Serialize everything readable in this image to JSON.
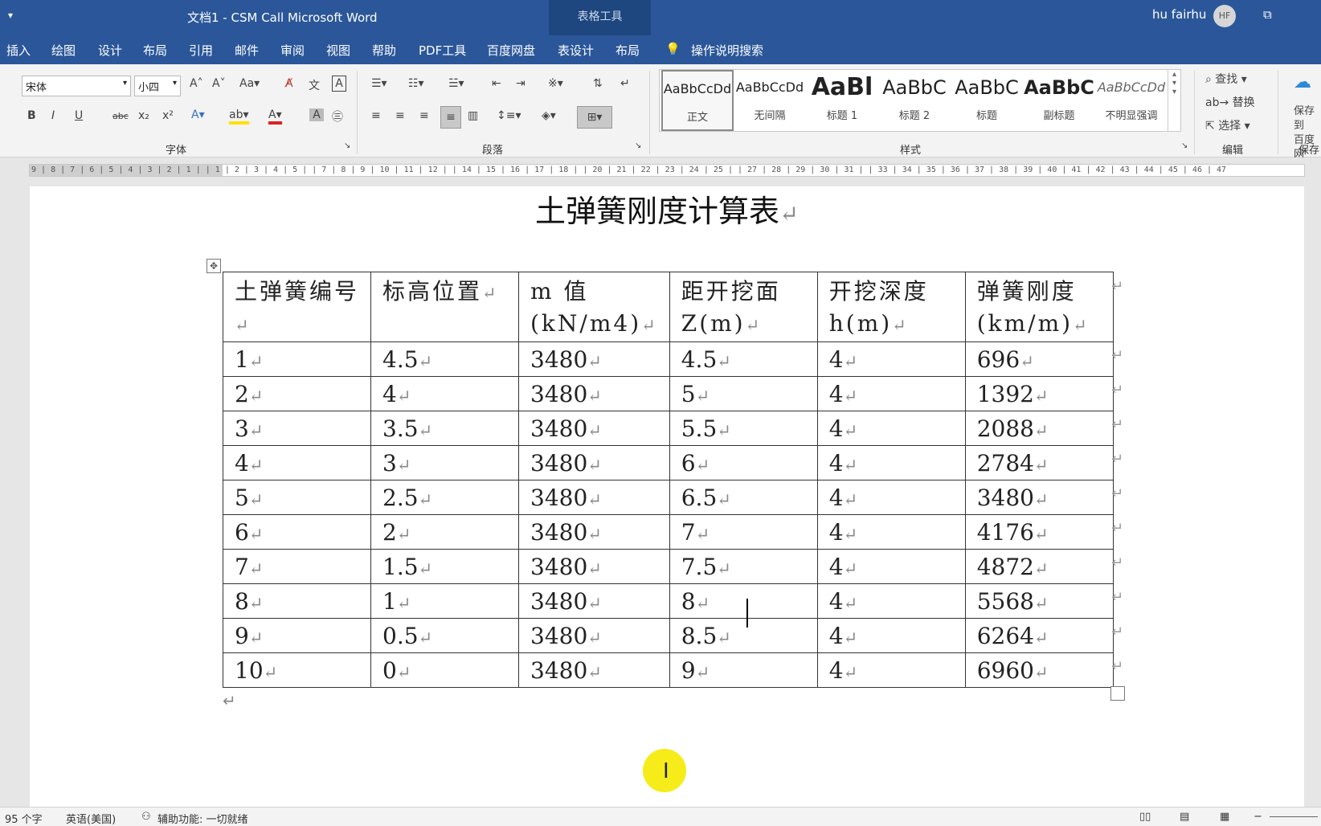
{
  "window": {
    "title": "文档1  -  CSM Call Microsoft Word",
    "context_tab": "表格工具",
    "user": "hu fairhu",
    "avatar": "HF"
  },
  "tabs": [
    "插入",
    "绘图",
    "设计",
    "布局",
    "引用",
    "邮件",
    "审阅",
    "视图",
    "帮助",
    "PDF工具",
    "百度网盘",
    "表设计",
    "布局"
  ],
  "search_label": "操作说明搜索",
  "font": {
    "name": "宋体",
    "size": "小四",
    "group_label": "字体"
  },
  "paragraph": {
    "group_label": "段落"
  },
  "styles": {
    "group_label": "样式",
    "items": [
      {
        "preview": "AaBbCcDd",
        "name": "正文"
      },
      {
        "preview": "AaBbCcDd",
        "name": "无间隔"
      },
      {
        "preview": "AaBl",
        "name": "标题 1"
      },
      {
        "preview": "AaBbC",
        "name": "标题 2"
      },
      {
        "preview": "AaBbC",
        "name": "标题"
      },
      {
        "preview": "AaBbC",
        "name": "副标题"
      },
      {
        "preview": "AaBbCcDd",
        "name": "不明显强调"
      }
    ]
  },
  "editing": {
    "find": "查找",
    "replace": "替换",
    "select": "选择",
    "group_label": "编辑"
  },
  "save": {
    "label1": "保存到",
    "label2": "百度网",
    "group_label": "保存"
  },
  "ruler": {
    "text": "9 | 8 | 7 | 6 | 5 | 4 | 3 | 2 | 1 |      | 1 | 2 | 3 | 4 | 5 |      | 7 | 8 | 9 | 10 | 11 | 12 |      | 14 | 15 | 16 | 17 | 18 |      | 20 | 21 | 22 | 23 | 24 | 25 |      | 27 | 28 | 29 | 30 | 31 |      | 33 | 34 | 35 | 36 | 37 | 38 |  39 | 40 | 41 | 42 | 43 | 44 | 45 | 46 | 47"
  },
  "document": {
    "title": "土弹簧刚度计算表",
    "headers": [
      "土弹簧编号",
      "标高位置",
      "m 值(kN/m4)",
      "距开挖面Z(m)",
      "开挖深度h(m)",
      "弹簧刚度(km/m)"
    ],
    "rows": [
      [
        "1",
        "4.5",
        "3480",
        "4.5",
        "4",
        "696"
      ],
      [
        "2",
        "4",
        "3480",
        "5",
        "4",
        "1392"
      ],
      [
        "3",
        "3.5",
        "3480",
        "5.5",
        "4",
        "2088"
      ],
      [
        "4",
        "3",
        "3480",
        "6",
        "4",
        "2784"
      ],
      [
        "5",
        "2.5",
        "3480",
        "6.5",
        "4",
        "3480"
      ],
      [
        "6",
        "2",
        "3480",
        "7",
        "4",
        "4176"
      ],
      [
        "7",
        "1.5",
        "3480",
        "7.5",
        "4",
        "4872"
      ],
      [
        "8",
        "1",
        "3480",
        "8",
        "4",
        "5568"
      ],
      [
        "9",
        "0.5",
        "3480",
        "8.5",
        "4",
        "6264"
      ],
      [
        "10",
        "0",
        "3480",
        "9",
        "4",
        "6960"
      ]
    ]
  },
  "status": {
    "words": "95 个字",
    "language": "英语(美国)",
    "accessibility": "辅助功能: 一切就绪"
  }
}
